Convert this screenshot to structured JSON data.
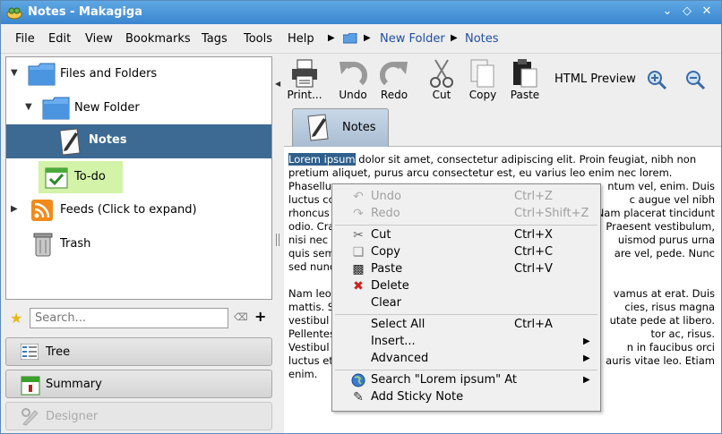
{
  "window": {
    "title": "Notes - Makagiga"
  },
  "menu": {
    "file": "File",
    "edit": "Edit",
    "view": "View",
    "bookmarks": "Bookmarks",
    "tags": "Tags",
    "tools": "Tools",
    "help": "Help"
  },
  "breadcrumb": {
    "folder": "New Folder",
    "note": "Notes"
  },
  "tree": {
    "files_and_folders": "Files and Folders",
    "new_folder": "New Folder",
    "notes": "Notes",
    "todo": "To-do",
    "feeds": "Feeds  (Click to expand)",
    "trash": "Trash"
  },
  "search": {
    "placeholder": "Search..."
  },
  "views": {
    "tree": "Tree",
    "summary": "Summary",
    "designer": "Designer"
  },
  "toolbar": {
    "print": "Print...",
    "undo": "Undo",
    "redo": "Redo",
    "cut": "Cut",
    "copy": "Copy",
    "paste": "Paste",
    "html_preview": "HTML Preview"
  },
  "tab": {
    "label": "Notes"
  },
  "editor": {
    "selected": "Lorem ipsum",
    "p1_rest": " dolor sit amet, consectetur adipiscing elit. Proin feugiat, nibh non pretium aliquet, purus arcu consectetur est, eu varius leo enim nec lorem.",
    "p1_lines": [
      "Phasellus",
      "luctus co",
      "rhoncus",
      "odio. Cra",
      "nisi nec",
      "quis sem",
      "sed nunc"
    ],
    "p1_right": [
      "ntum vel, enim. Duis",
      "c augue vel nibh",
      "Nam placerat tincidunt",
      "Praesent vestibulum,",
      "uismod purus urna",
      "are vel, pede. Nunc",
      ""
    ],
    "p2_lines": [
      "Nam leo",
      "mattis. S",
      "vestibul",
      "Pellentes",
      "Vestibul",
      "luctus et",
      "enim."
    ],
    "p2_right": [
      "vamus at erat. Duis",
      "cies, risus magna",
      "utate pede at libero.",
      "tor ac, risus.",
      "n in faucibus orci",
      "auris vitae leo. Etiam",
      ""
    ]
  },
  "context_menu": {
    "undo": "Undo",
    "undo_sc": "Ctrl+Z",
    "redo": "Redo",
    "redo_sc": "Ctrl+Shift+Z",
    "cut": "Cut",
    "cut_sc": "Ctrl+X",
    "copy": "Copy",
    "copy_sc": "Ctrl+C",
    "paste": "Paste",
    "paste_sc": "Ctrl+V",
    "delete": "Delete",
    "clear": "Clear",
    "select_all": "Select All",
    "select_all_sc": "Ctrl+A",
    "insert": "Insert...",
    "advanced": "Advanced",
    "search": "Search \"Lorem ipsum\" At",
    "sticky": "Add Sticky Note"
  },
  "colors": {
    "titlebar": "#4a96d8",
    "selection": "#3c6a92",
    "todo_highlight": "#d2f3a8",
    "link": "#1f4fa8"
  }
}
